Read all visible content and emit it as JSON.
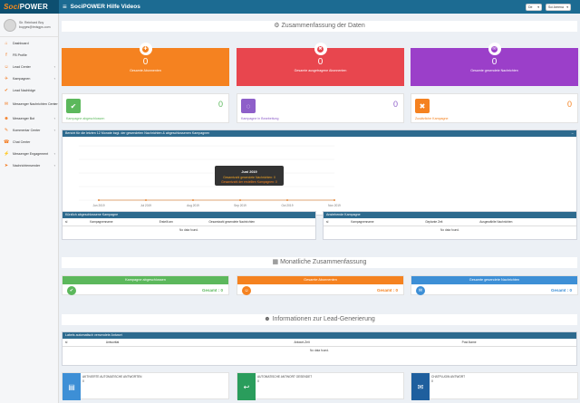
{
  "topbar": {
    "logo_soci": "Soci",
    "logo_power": "POWER",
    "menu_glyph": "≡",
    "title": "SociPOWER Hilfe Videos",
    "lang": "De",
    "account": "Sci Areena"
  },
  "user": {
    "name": "Sir. Reinhard Boy",
    "email": "boyges@tmisgps.com"
  },
  "sidebar": {
    "items": [
      {
        "label": "Dashboard",
        "icon": "dashboard-icon",
        "glyph": "⌂",
        "chev": false
      },
      {
        "label": "FB Profile",
        "icon": "facebook-icon",
        "glyph": "f",
        "chev": false
      },
      {
        "label": "Lead Center",
        "icon": "users-icon",
        "glyph": "☺",
        "chev": true
      },
      {
        "label": "Kampagnen",
        "icon": "bullhorn-icon",
        "glyph": "✈",
        "chev": true
      },
      {
        "label": "Lead Nachfolge",
        "icon": "user-check-icon",
        "glyph": "✔",
        "chev": false
      },
      {
        "label": "Messenger Nachrichten Center",
        "icon": "envelope-icon",
        "glyph": "✉",
        "chev": true
      },
      {
        "label": "Messenger Bot",
        "icon": "robot-icon",
        "glyph": "☻",
        "chev": true
      },
      {
        "label": "Kommentar Center",
        "icon": "comment-icon",
        "glyph": "✎",
        "chev": true
      },
      {
        "label": "Chat Center",
        "icon": "chat-icon",
        "glyph": "☎",
        "chev": false
      },
      {
        "label": "Messenger Engagement",
        "icon": "bolt-icon",
        "glyph": "⚡",
        "chev": true
      },
      {
        "label": "Nachrichtensender",
        "icon": "send-icon",
        "glyph": "➤",
        "chev": true
      }
    ]
  },
  "summary": {
    "icon_glyph": "⚙",
    "title": "Zusammenfassung der Daten",
    "kpis": [
      {
        "value": "0",
        "label": "Gesamte Abonnenten",
        "color": "#f58220",
        "glyph": "✚"
      },
      {
        "value": "0",
        "label": "Gesamte ausgetragene Abonnenten",
        "color": "#e8464e",
        "glyph": "✖"
      },
      {
        "value": "0",
        "label": "Gesamte gesendete Nachrichten",
        "color": "#9b3fc9",
        "glyph": "✉"
      }
    ],
    "small": [
      {
        "value": "0",
        "label": "Kampagne abgeschlossen",
        "color": "#5cb85c",
        "glyph": "✔"
      },
      {
        "value": "0",
        "label": "Kampagne in Bearbeitung",
        "color": "#8e5fc9",
        "glyph": "◌"
      },
      {
        "value": "0",
        "label": "Zusätzliche Kampagne",
        "color": "#f58220",
        "glyph": "✖"
      }
    ]
  },
  "chart_panel": {
    "title": "Bericht für die letzten 12 Monate bzgl. der gesendeten Nachrichten & abgeschlossenen Kampagnen",
    "collapse": "−",
    "x_ticks": [
      "Jun 2019",
      "Jul 2019",
      "Aug 2019",
      "Sep 2019",
      "Oct 2019",
      "Nov 2019"
    ],
    "y_ticks": [
      "",
      "",
      "",
      "",
      ""
    ],
    "tooltip": {
      "title": "Juni 2019",
      "line1": "Gesamtzahl gesendete Nachrichten: 0",
      "line2": "Gesamtzahl der erstellten Kampagnen: 0"
    }
  },
  "chart_data": {
    "type": "line",
    "categories": [
      "Jun 2019",
      "Jul 2019",
      "Aug 2019",
      "Sep 2019",
      "Oct 2019",
      "Nov 2019"
    ],
    "series": [
      {
        "values": [
          0,
          0,
          0,
          0,
          0,
          0
        ]
      },
      {
        "values": [
          0,
          0,
          0,
          0,
          0,
          0
        ]
      }
    ]
  },
  "table_left": {
    "title": "Kürzlich abgeschlossene Kampagne",
    "cols": [
      "sl",
      "Kampagnenname",
      "Erstellt am",
      "Gesamtzahl gesendete Nachrichten"
    ],
    "empty": "No data found."
  },
  "table_right": {
    "title": "Anstehende Kampagne",
    "cols": [
      "sl",
      "Kampagnenname",
      "Geplante Zeit",
      "Ausgewählte Nachrichten"
    ],
    "empty": "No data found."
  },
  "monthly": {
    "icon_glyph": "▦",
    "title": "Monatliche Zusammenfassung",
    "banners": [
      {
        "label": "Kampagne abgeschlossen",
        "total": "Gesamt : 0",
        "color": "#5cb85c",
        "glyph": "✔"
      },
      {
        "label": "Gesamte Abonnenten",
        "total": "Gesamt : 0",
        "color": "#f58220",
        "glyph": "☺"
      },
      {
        "label": "Gesamte gesendete Nachrichten",
        "total": "Gesamt : 0",
        "color": "#3d8fd6",
        "glyph": "✉"
      }
    ]
  },
  "lead": {
    "icon_glyph": "☻",
    "title": "Informationen zur Lead-Generierung",
    "table": {
      "title": "Labels automatisch versendete Antwort",
      "cols": [
        "sl",
        "Antworttat",
        "Antwort-Zeit",
        "Post-Name"
      ],
      "empty": "No data found."
    },
    "stats": [
      {
        "label": "AKTIVIERTE AUTOMATISCHE ANTWORTEN",
        "value": "0",
        "color": "#3d8fd6",
        "glyph": "▤"
      },
      {
        "label": "AUTOMATISCHE ANTWORT GESENDET",
        "value": "0",
        "color": "#2a9d5c",
        "glyph": "↩"
      },
      {
        "label": "CHATPLUGIN ANTWORT",
        "value": "0",
        "color": "#1f5f9e",
        "glyph": "✉"
      }
    ]
  }
}
